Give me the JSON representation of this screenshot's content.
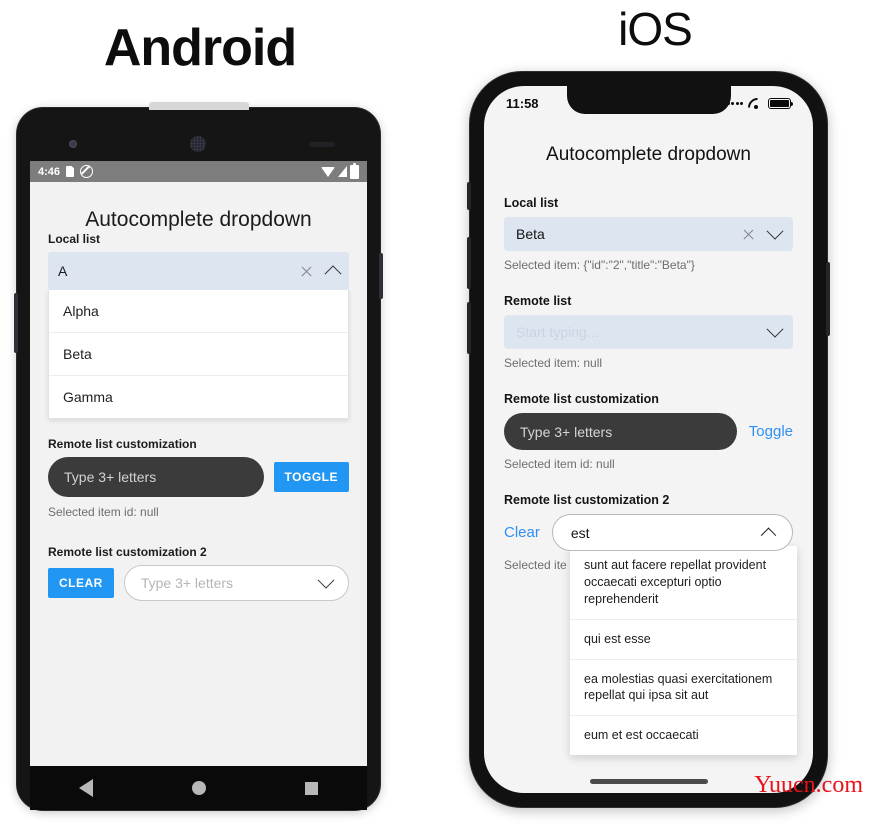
{
  "headings": {
    "android": "Android",
    "ios": "iOS"
  },
  "android": {
    "status_bar": {
      "time": "4:46",
      "left_icons": [
        "sd-card-icon",
        "no-entry-icon"
      ],
      "right_icons": [
        "wifi-icon",
        "signal-icon",
        "battery-icon"
      ]
    },
    "app_title": "Autocomplete dropdown",
    "local_list": {
      "label": "Local list",
      "value": "A",
      "clear_icon": "close-icon",
      "toggle_icon": "chevron-up-icon",
      "options": [
        "Alpha",
        "Beta",
        "Gamma"
      ]
    },
    "remote_customization": {
      "label": "Remote list customization",
      "placeholder": "Type 3+ letters",
      "button": "TOGGLE",
      "helper": "Selected item id: null"
    },
    "remote_customization_2": {
      "label": "Remote list customization 2",
      "button": "CLEAR",
      "placeholder": "Type 3+ letters",
      "toggle_icon": "chevron-down-icon"
    },
    "nav_bar": [
      "back-icon",
      "home-icon",
      "recents-icon"
    ]
  },
  "ios": {
    "status_bar": {
      "time": "11:58",
      "right_icons": [
        "cellular-dots-icon",
        "wifi-icon",
        "battery-icon"
      ]
    },
    "app_title": "Autocomplete dropdown",
    "local_list": {
      "label": "Local list",
      "value": "Beta",
      "clear_icon": "close-icon",
      "toggle_icon": "chevron-down-icon",
      "helper": "Selected item: {\"id\":\"2\",\"title\":\"Beta\"}"
    },
    "remote_list": {
      "label": "Remote list",
      "placeholder": "Start typing...",
      "toggle_icon": "chevron-down-icon",
      "helper": "Selected item: null"
    },
    "remote_customization": {
      "label": "Remote list customization",
      "placeholder": "Type 3+ letters",
      "button": "Toggle",
      "helper": "Selected item id: null"
    },
    "remote_customization_2": {
      "label": "Remote list customization 2",
      "button": "Clear",
      "value": "est",
      "toggle_icon": "chevron-up-icon",
      "helper": "Selected ite",
      "options": [
        "sunt aut facere repellat provident occaecati excepturi optio reprehenderit",
        "qui est esse",
        "ea molestias quasi exercitationem repellat qui ipsa sit aut",
        "eum et est occaecati"
      ]
    }
  },
  "watermark": "Yuucn.com",
  "colors": {
    "accent_blue": "#2196f3",
    "ios_link_blue": "#2f8ff5",
    "field_fill": "#dde5f0",
    "dark_pill": "#3b3b3b",
    "watermark_red": "#e8121a"
  }
}
